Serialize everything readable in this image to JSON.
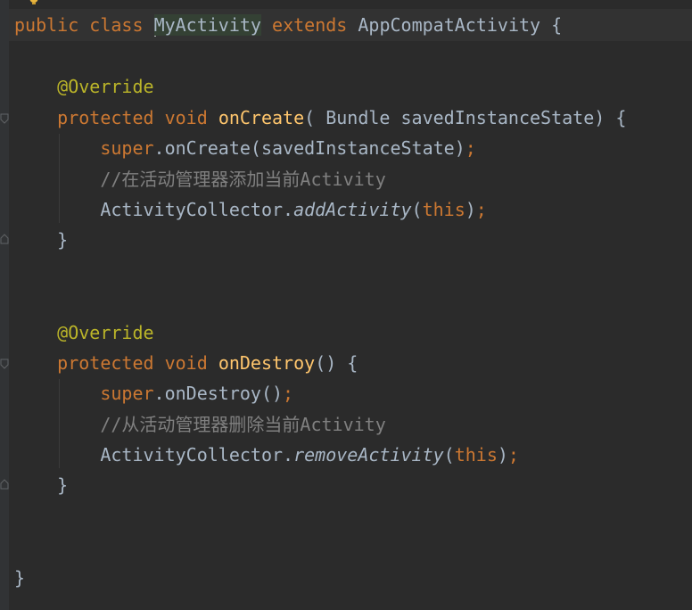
{
  "editor": {
    "lines": {
      "l1": {
        "kw1": "public",
        "kw2": "class",
        "classname": "MyActivity",
        "kw3": "extends",
        "superclass": "AppCompatActivity",
        "brace": "{"
      },
      "l3": {
        "annotation": "@Override"
      },
      "l4": {
        "kw1": "protected",
        "kw2": "void",
        "method": "onCreate",
        "params": "( Bundle savedInstanceState) {"
      },
      "l5": {
        "kw": "super",
        "rest": ".onCreate(savedInstanceState)",
        "semi": ";"
      },
      "l6": {
        "comment": "//在活动管理器添加当前Activity"
      },
      "l7": {
        "obj": "ActivityCollector.",
        "method": "addActivity",
        "open": "(",
        "arg": "this",
        "close": ")",
        "semi": ";"
      },
      "l8": {
        "brace": "}"
      },
      "l11": {
        "annotation": "@Override"
      },
      "l12": {
        "kw1": "protected",
        "kw2": "void",
        "method": "onDestroy",
        "params": "() {"
      },
      "l13": {
        "kw": "super",
        "rest": ".onDestroy()",
        "semi": ";"
      },
      "l14": {
        "comment": "//从活动管理器删除当前Activity"
      },
      "l15": {
        "obj": "ActivityCollector.",
        "method": "removeActivity",
        "open": "(",
        "arg": "this",
        "close": ")",
        "semi": ";"
      },
      "l16": {
        "brace": "}"
      },
      "l19": {
        "brace": "}"
      }
    },
    "icons": {
      "bulb": "intention-bulb-icon",
      "fold": "fold-marker-icon"
    },
    "colors": {
      "background": "#2b2b2b",
      "keyword": "#cc7832",
      "annotation": "#bbb529",
      "method_declaration": "#ffc66d",
      "default_text": "#a9b7c6",
      "comment": "#808080"
    }
  }
}
